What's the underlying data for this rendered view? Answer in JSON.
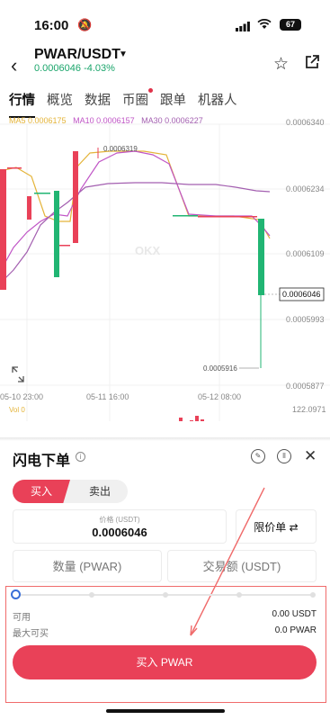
{
  "status_bar": {
    "time": "16:00",
    "battery": "67"
  },
  "header": {
    "pair": "PWAR/USDT",
    "price": "0.0006046",
    "change": "-4.03%"
  },
  "tabs": [
    {
      "label": "行情",
      "active": true
    },
    {
      "label": "概览",
      "active": false
    },
    {
      "label": "数据",
      "active": false
    },
    {
      "label": "币圈",
      "active": false,
      "dot": true
    },
    {
      "label": "跟单",
      "active": false
    },
    {
      "label": "机器人",
      "active": false
    }
  ],
  "chart_data": {
    "type": "candlestick",
    "ma_labels": [
      {
        "text": "MA5 0.0006175",
        "color": "#e4b43a"
      },
      {
        "text": "MA10 0.0006157",
        "color": "#c055c6"
      },
      {
        "text": "MA30 0.0006227",
        "color": "#a35fb0"
      }
    ],
    "y_ticks": [
      "0.0006340",
      "0.0006234",
      "0.0006109",
      "0.0005993",
      "0.0005877"
    ],
    "x_ticks": [
      "05-10 23:00",
      "05-11 16:00",
      "05-12 08:00"
    ],
    "current_price_label": "0.0006046",
    "high_label": "0.0006319",
    "low_label": "0.0005916",
    "watermark": "OKX",
    "volume_label": "Vol 0",
    "volume_max": "122.0971",
    "colors": {
      "up": "#21b573",
      "down": "#e94158"
    }
  },
  "sheet": {
    "title": "闪电下单",
    "buy_tab": "买入",
    "sell_tab": "卖出",
    "price_label": "价格 (USDT)",
    "price_value": "0.0006046",
    "order_type": "限价单",
    "qty_placeholder": "数量 (PWAR)",
    "amount_placeholder": "交易额 (USDT)",
    "available_label": "可用",
    "available_value": "0.00 USDT",
    "max_buy_label": "最大可买",
    "max_buy_value": "0.0 PWAR",
    "buy_button": "买入 PWAR",
    "slider_level": 0
  },
  "colors": {
    "accent_red": "#e94158",
    "accent_green": "#1aa56b",
    "annotation_red": "#f06b6b"
  }
}
